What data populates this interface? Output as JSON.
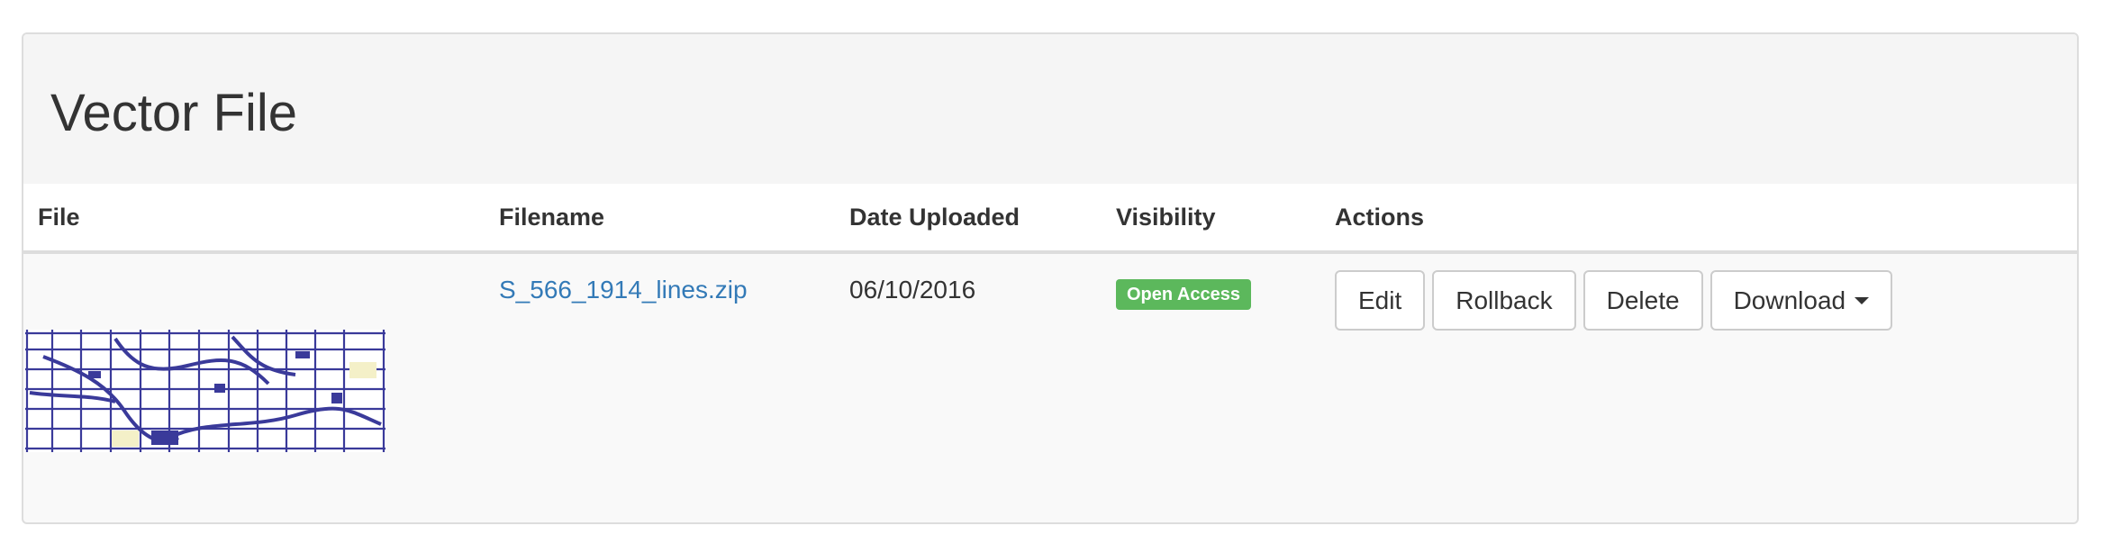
{
  "panel": {
    "title": "Vector File"
  },
  "table": {
    "headers": {
      "file": "File",
      "filename": "Filename",
      "date_uploaded": "Date Uploaded",
      "visibility": "Visibility",
      "actions": "Actions"
    },
    "rows": [
      {
        "thumbnail": "map-thumbnail",
        "filename": "S_566_1914_lines.zip",
        "date_uploaded": "06/10/2016",
        "visibility": "Open Access",
        "actions": {
          "edit": "Edit",
          "rollback": "Rollback",
          "delete": "Delete",
          "download": "Download"
        }
      }
    ]
  },
  "colors": {
    "link": "#337ab7",
    "badge_open_access": "#5cb85c",
    "map_lines": "#3a3a9a",
    "panel_heading_bg": "#f5f5f5",
    "row_bg": "#f9f9f9"
  },
  "icons": {
    "download_caret": "caret-down-icon"
  }
}
